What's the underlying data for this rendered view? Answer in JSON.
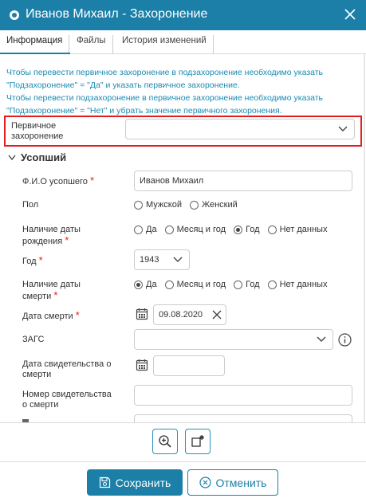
{
  "window": {
    "title": "Иванов Михаил - Захоронение"
  },
  "tabs": [
    {
      "label": "Информация",
      "active": true
    },
    {
      "label": "Файлы",
      "active": false
    },
    {
      "label": "История изменений",
      "active": false
    }
  ],
  "info_lines": [
    "Чтобы перевести первичное захоронение в подзахоронение необходимо указать",
    "\"Подзахоронение\" = \"Да\" и указать первичное захоронение.",
    "Чтобы перевести подзахоронение в первичное захоронение необходимо указать",
    "\"Подзахоронение\" = \"Нет\" и убрать значение первичного захоронения."
  ],
  "primary_burial": {
    "label_line1": "Первичное",
    "label_line2": "захоронение",
    "value": ""
  },
  "section": {
    "title": "Усопший"
  },
  "fields": {
    "fio": {
      "label": "Ф.И.О усопшего",
      "required_mark": "*",
      "value": "Иванов Михаил"
    },
    "gender": {
      "label": "Пол",
      "options": [
        "Мужской",
        "Женский"
      ],
      "selected": null
    },
    "birth_date_presence": {
      "label_line1": "Наличие даты",
      "label_line2": "рождения",
      "required_mark": "*",
      "options": [
        "Да",
        "Месяц и год",
        "Год",
        "Нет данных"
      ],
      "selected": "Год"
    },
    "year": {
      "label": "Год",
      "required_mark": "*",
      "value": "1943"
    },
    "death_date_presence": {
      "label_line1": "Наличие даты",
      "label_line2": "смерти",
      "required_mark": "*",
      "options": [
        "Да",
        "Месяц и год",
        "Год",
        "Нет данных"
      ],
      "selected": "Да"
    },
    "death_date": {
      "label": "Дата смерти",
      "required_mark": "*",
      "value": "09.08.2020"
    },
    "zags": {
      "label": "ЗАГС",
      "value": ""
    },
    "certificate_date": {
      "label_line1": "Дата свидетельства о",
      "label_line2": "смерти",
      "value": ""
    },
    "certificate_number": {
      "label_line1": "Номер свидетельства",
      "label_line2": "о смерти",
      "value": ""
    }
  },
  "buttons": {
    "save": "Сохранить",
    "cancel": "Отменить"
  },
  "colors": {
    "primary": "#1b7fa8",
    "info_text": "#1a8bb3",
    "highlight": "#e01e1e",
    "required": "#e02020"
  }
}
